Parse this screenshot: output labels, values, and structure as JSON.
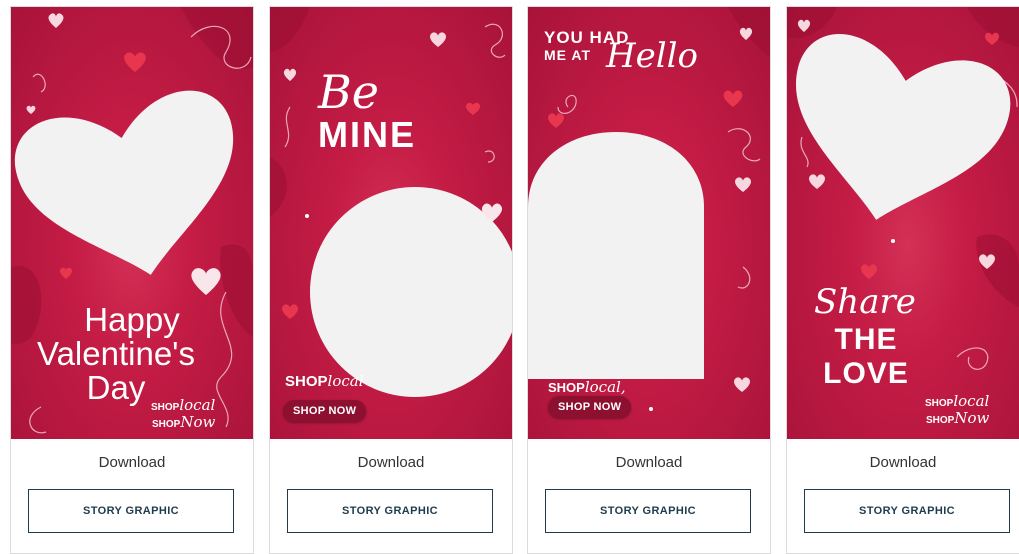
{
  "download_label": "Download",
  "story_button_label": "STORY GRAPHIC",
  "colors": {
    "graphic_red": "#c41c45",
    "button_border": "#1f3b4d",
    "photo_placeholder": "#f2f2f2"
  },
  "cards": [
    {
      "line1": "Happy",
      "line2": "Valentine's",
      "line3": "Day",
      "logo_shop1": "SHOP",
      "logo_local": "local",
      "logo_shop2": "SHOP",
      "logo_now": "Now"
    },
    {
      "script": "Be",
      "headline": "MINE",
      "logo_shop": "SHOP",
      "logo_local": "local",
      "pill": "SHOP NOW"
    },
    {
      "line1": "YOU HAD",
      "line2": "ME AT",
      "script": "Hello",
      "logo_shop": "SHOP",
      "logo_local": "local,",
      "pill": "SHOP NOW"
    },
    {
      "script": "Share",
      "line1": "THE",
      "line2": "LOVE",
      "logo_shop1": "SHOP",
      "logo_local": "local",
      "logo_shop2": "SHOP",
      "logo_now": "Now"
    }
  ]
}
